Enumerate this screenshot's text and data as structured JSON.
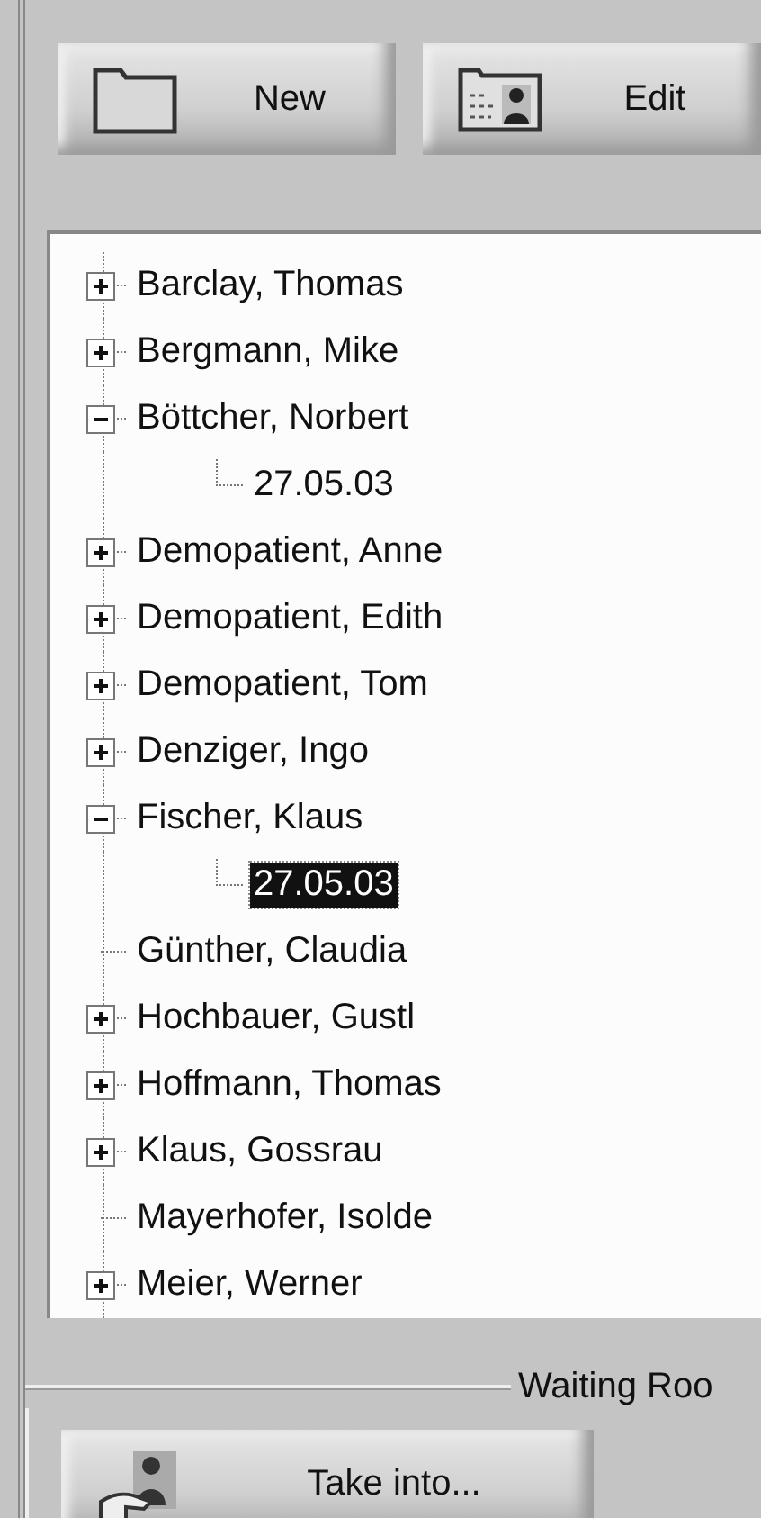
{
  "toolbar": {
    "buttons": [
      {
        "kind": "folder",
        "label": "New"
      },
      {
        "kind": "card",
        "label": "Edit"
      }
    ]
  },
  "tree": {
    "items": [
      {
        "label": "Barclay, Thomas",
        "expanded": false,
        "selected": false
      },
      {
        "label": "Bergmann, Mike",
        "expanded": false,
        "selected": false
      },
      {
        "label": "Böttcher, Norbert",
        "expanded": true,
        "selected": false,
        "children": [
          {
            "label": "27.05.03",
            "selected": false
          }
        ]
      },
      {
        "label": "Demopatient, Anne",
        "expanded": false,
        "selected": false
      },
      {
        "label": "Demopatient, Edith",
        "expanded": false,
        "selected": false
      },
      {
        "label": "Demopatient, Tom",
        "expanded": false,
        "selected": false
      },
      {
        "label": "Denziger, Ingo",
        "expanded": false,
        "selected": false
      },
      {
        "label": "Fischer, Klaus",
        "expanded": true,
        "selected": false,
        "children": [
          {
            "label": "27.05.03",
            "selected": true
          }
        ]
      },
      {
        "label": "Günther, Claudia",
        "selected": false
      },
      {
        "label": "Hochbauer, Gustl",
        "expanded": false,
        "selected": false
      },
      {
        "label": "Hoffmann, Thomas",
        "expanded": false,
        "selected": false
      },
      {
        "label": "Klaus, Gossrau",
        "expanded": false,
        "selected": false
      },
      {
        "label": "Mayerhofer, Isolde",
        "selected": false
      },
      {
        "label": "Meier, Werner",
        "expanded": false,
        "selected": false
      }
    ]
  },
  "waiting_room": {
    "title": "Waiting Roo",
    "button": {
      "kind": "hand",
      "label": "Take into..."
    }
  }
}
